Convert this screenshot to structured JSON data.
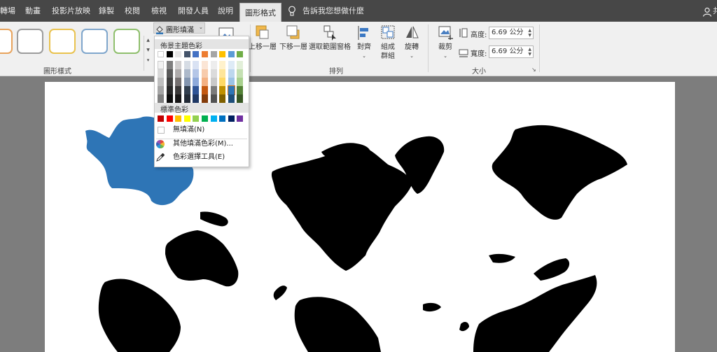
{
  "tabs": [
    {
      "label": "轉場"
    },
    {
      "label": "動畫"
    },
    {
      "label": "投影片放映"
    },
    {
      "label": "錄製"
    },
    {
      "label": "校閱"
    },
    {
      "label": "檢視"
    },
    {
      "label": "開發人員"
    },
    {
      "label": "說明"
    },
    {
      "label": "圖形格式",
      "active": true
    },
    {
      "label": "告訴我您想做什麼"
    }
  ],
  "user_label": "共",
  "ribbon": {
    "shape_styles_label": "圖形樣式",
    "shape_fill_label": "圖形填滿",
    "arrange": {
      "label": "排列",
      "bring_forward_label": "上移一層",
      "send_backward_label": "下移一層",
      "selection_pane_label": "選取範圍窗格",
      "align_label": "對齊",
      "group_label": "組成群組",
      "rotate_label": "旋轉"
    },
    "size": {
      "label": "大小",
      "crop_label": "裁剪",
      "height_label": "高度:",
      "height_value": "6.69 公分",
      "width_label": "寬度:",
      "width_value": "6.69 公分"
    },
    "style_border_colors": [
      "#e8a35c",
      "#9c9c9c",
      "#e9c24e",
      "#7fa6cc",
      "#8fbf6d"
    ]
  },
  "fill_menu": {
    "theme_colors_title": "佈景主題色彩",
    "standard_colors_title": "標準色彩",
    "no_fill_label": "無填滿(N)",
    "more_colors_label": "其他填滿色彩(M)...",
    "eyedropper_label": "色彩選擇工具(E)",
    "theme_top_row": [
      "#ffffff",
      "#000000",
      "#e7e6e6",
      "#44546a",
      "#4472c4",
      "#ed7d31",
      "#a5a5a5",
      "#ffc000",
      "#5b9bd5",
      "#70ad47"
    ],
    "theme_shades": [
      [
        "#f2f2f2",
        "#7f7f7f",
        "#d0cece",
        "#d6dce4",
        "#d9e2f3",
        "#fbe5d5",
        "#ededed",
        "#fff2cc",
        "#deebf6",
        "#e2efd9"
      ],
      [
        "#d8d8d8",
        "#595959",
        "#aeabab",
        "#adb9ca",
        "#b4c6e7",
        "#f7cbac",
        "#dbdbdb",
        "#fee599",
        "#bdd7ee",
        "#c5e0b3"
      ],
      [
        "#bfbfbf",
        "#3f3f3f",
        "#757070",
        "#8496b0",
        "#8eaadb",
        "#f4b183",
        "#c9c9c9",
        "#ffd965",
        "#9cc3e5",
        "#a8d08d"
      ],
      [
        "#a5a5a5",
        "#262626",
        "#3a3838",
        "#323f4f",
        "#2f5496",
        "#c45911",
        "#7b7b7b",
        "#bf9000",
        "#2e75b5",
        "#538135"
      ],
      [
        "#7f7f7f",
        "#0c0c0c",
        "#171616",
        "#222a35",
        "#1f3864",
        "#843c0b",
        "#525252",
        "#7f6000",
        "#1e4e79",
        "#375623"
      ]
    ],
    "standard_colors": [
      "#c00000",
      "#ff0000",
      "#ffc000",
      "#ffff00",
      "#92d050",
      "#00b050",
      "#00b0f0",
      "#0070c0",
      "#002060",
      "#7030a0"
    ],
    "selected_shade": {
      "row": 3,
      "col": 8
    }
  },
  "map_colors": {
    "selected_shape": "#2e75b6",
    "land": "#000000"
  }
}
